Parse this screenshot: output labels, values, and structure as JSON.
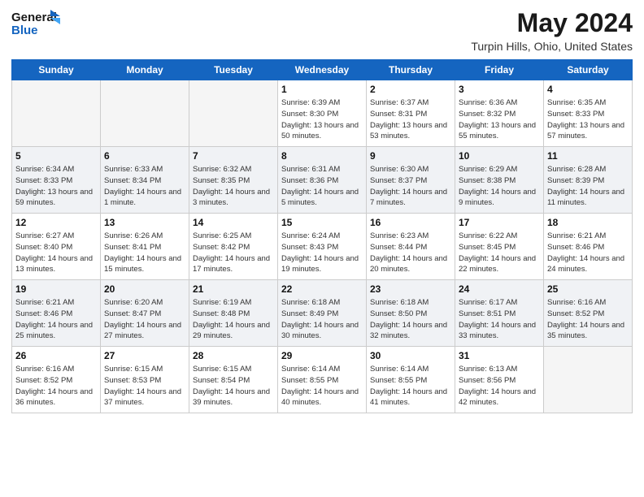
{
  "header": {
    "logo_line1": "General",
    "logo_line2": "Blue",
    "title": "May 2024",
    "subtitle": "Turpin Hills, Ohio, United States"
  },
  "days_of_week": [
    "Sunday",
    "Monday",
    "Tuesday",
    "Wednesday",
    "Thursday",
    "Friday",
    "Saturday"
  ],
  "weeks": [
    [
      {
        "num": "",
        "sunrise": "",
        "sunset": "",
        "daylight": ""
      },
      {
        "num": "",
        "sunrise": "",
        "sunset": "",
        "daylight": ""
      },
      {
        "num": "",
        "sunrise": "",
        "sunset": "",
        "daylight": ""
      },
      {
        "num": "1",
        "sunrise": "Sunrise: 6:39 AM",
        "sunset": "Sunset: 8:30 PM",
        "daylight": "Daylight: 13 hours and 50 minutes."
      },
      {
        "num": "2",
        "sunrise": "Sunrise: 6:37 AM",
        "sunset": "Sunset: 8:31 PM",
        "daylight": "Daylight: 13 hours and 53 minutes."
      },
      {
        "num": "3",
        "sunrise": "Sunrise: 6:36 AM",
        "sunset": "Sunset: 8:32 PM",
        "daylight": "Daylight: 13 hours and 55 minutes."
      },
      {
        "num": "4",
        "sunrise": "Sunrise: 6:35 AM",
        "sunset": "Sunset: 8:33 PM",
        "daylight": "Daylight: 13 hours and 57 minutes."
      }
    ],
    [
      {
        "num": "5",
        "sunrise": "Sunrise: 6:34 AM",
        "sunset": "Sunset: 8:33 PM",
        "daylight": "Daylight: 13 hours and 59 minutes."
      },
      {
        "num": "6",
        "sunrise": "Sunrise: 6:33 AM",
        "sunset": "Sunset: 8:34 PM",
        "daylight": "Daylight: 14 hours and 1 minute."
      },
      {
        "num": "7",
        "sunrise": "Sunrise: 6:32 AM",
        "sunset": "Sunset: 8:35 PM",
        "daylight": "Daylight: 14 hours and 3 minutes."
      },
      {
        "num": "8",
        "sunrise": "Sunrise: 6:31 AM",
        "sunset": "Sunset: 8:36 PM",
        "daylight": "Daylight: 14 hours and 5 minutes."
      },
      {
        "num": "9",
        "sunrise": "Sunrise: 6:30 AM",
        "sunset": "Sunset: 8:37 PM",
        "daylight": "Daylight: 14 hours and 7 minutes."
      },
      {
        "num": "10",
        "sunrise": "Sunrise: 6:29 AM",
        "sunset": "Sunset: 8:38 PM",
        "daylight": "Daylight: 14 hours and 9 minutes."
      },
      {
        "num": "11",
        "sunrise": "Sunrise: 6:28 AM",
        "sunset": "Sunset: 8:39 PM",
        "daylight": "Daylight: 14 hours and 11 minutes."
      }
    ],
    [
      {
        "num": "12",
        "sunrise": "Sunrise: 6:27 AM",
        "sunset": "Sunset: 8:40 PM",
        "daylight": "Daylight: 14 hours and 13 minutes."
      },
      {
        "num": "13",
        "sunrise": "Sunrise: 6:26 AM",
        "sunset": "Sunset: 8:41 PM",
        "daylight": "Daylight: 14 hours and 15 minutes."
      },
      {
        "num": "14",
        "sunrise": "Sunrise: 6:25 AM",
        "sunset": "Sunset: 8:42 PM",
        "daylight": "Daylight: 14 hours and 17 minutes."
      },
      {
        "num": "15",
        "sunrise": "Sunrise: 6:24 AM",
        "sunset": "Sunset: 8:43 PM",
        "daylight": "Daylight: 14 hours and 19 minutes."
      },
      {
        "num": "16",
        "sunrise": "Sunrise: 6:23 AM",
        "sunset": "Sunset: 8:44 PM",
        "daylight": "Daylight: 14 hours and 20 minutes."
      },
      {
        "num": "17",
        "sunrise": "Sunrise: 6:22 AM",
        "sunset": "Sunset: 8:45 PM",
        "daylight": "Daylight: 14 hours and 22 minutes."
      },
      {
        "num": "18",
        "sunrise": "Sunrise: 6:21 AM",
        "sunset": "Sunset: 8:46 PM",
        "daylight": "Daylight: 14 hours and 24 minutes."
      }
    ],
    [
      {
        "num": "19",
        "sunrise": "Sunrise: 6:21 AM",
        "sunset": "Sunset: 8:46 PM",
        "daylight": "Daylight: 14 hours and 25 minutes."
      },
      {
        "num": "20",
        "sunrise": "Sunrise: 6:20 AM",
        "sunset": "Sunset: 8:47 PM",
        "daylight": "Daylight: 14 hours and 27 minutes."
      },
      {
        "num": "21",
        "sunrise": "Sunrise: 6:19 AM",
        "sunset": "Sunset: 8:48 PM",
        "daylight": "Daylight: 14 hours and 29 minutes."
      },
      {
        "num": "22",
        "sunrise": "Sunrise: 6:18 AM",
        "sunset": "Sunset: 8:49 PM",
        "daylight": "Daylight: 14 hours and 30 minutes."
      },
      {
        "num": "23",
        "sunrise": "Sunrise: 6:18 AM",
        "sunset": "Sunset: 8:50 PM",
        "daylight": "Daylight: 14 hours and 32 minutes."
      },
      {
        "num": "24",
        "sunrise": "Sunrise: 6:17 AM",
        "sunset": "Sunset: 8:51 PM",
        "daylight": "Daylight: 14 hours and 33 minutes."
      },
      {
        "num": "25",
        "sunrise": "Sunrise: 6:16 AM",
        "sunset": "Sunset: 8:52 PM",
        "daylight": "Daylight: 14 hours and 35 minutes."
      }
    ],
    [
      {
        "num": "26",
        "sunrise": "Sunrise: 6:16 AM",
        "sunset": "Sunset: 8:52 PM",
        "daylight": "Daylight: 14 hours and 36 minutes."
      },
      {
        "num": "27",
        "sunrise": "Sunrise: 6:15 AM",
        "sunset": "Sunset: 8:53 PM",
        "daylight": "Daylight: 14 hours and 37 minutes."
      },
      {
        "num": "28",
        "sunrise": "Sunrise: 6:15 AM",
        "sunset": "Sunset: 8:54 PM",
        "daylight": "Daylight: 14 hours and 39 minutes."
      },
      {
        "num": "29",
        "sunrise": "Sunrise: 6:14 AM",
        "sunset": "Sunset: 8:55 PM",
        "daylight": "Daylight: 14 hours and 40 minutes."
      },
      {
        "num": "30",
        "sunrise": "Sunrise: 6:14 AM",
        "sunset": "Sunset: 8:55 PM",
        "daylight": "Daylight: 14 hours and 41 minutes."
      },
      {
        "num": "31",
        "sunrise": "Sunrise: 6:13 AM",
        "sunset": "Sunset: 8:56 PM",
        "daylight": "Daylight: 14 hours and 42 minutes."
      },
      {
        "num": "",
        "sunrise": "",
        "sunset": "",
        "daylight": ""
      }
    ]
  ]
}
